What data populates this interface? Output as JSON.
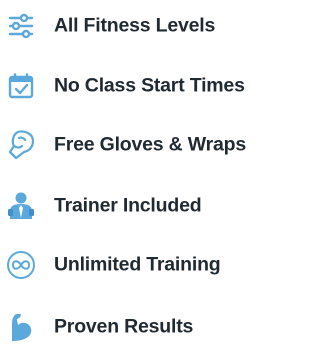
{
  "accent_color": "#5ba8dc",
  "text_color": "#1f2a33",
  "features": [
    {
      "icon": "sliders-icon",
      "label": "All Fitness Levels"
    },
    {
      "icon": "calendar-check-icon",
      "label": "No Class Start Times"
    },
    {
      "icon": "boxing-glove-icon",
      "label": "Free Gloves & Wraps"
    },
    {
      "icon": "trainer-icon",
      "label": "Trainer Included"
    },
    {
      "icon": "infinity-icon",
      "label": "Unlimited Training"
    },
    {
      "icon": "flexed-arm-icon",
      "label": "Proven Results"
    }
  ]
}
